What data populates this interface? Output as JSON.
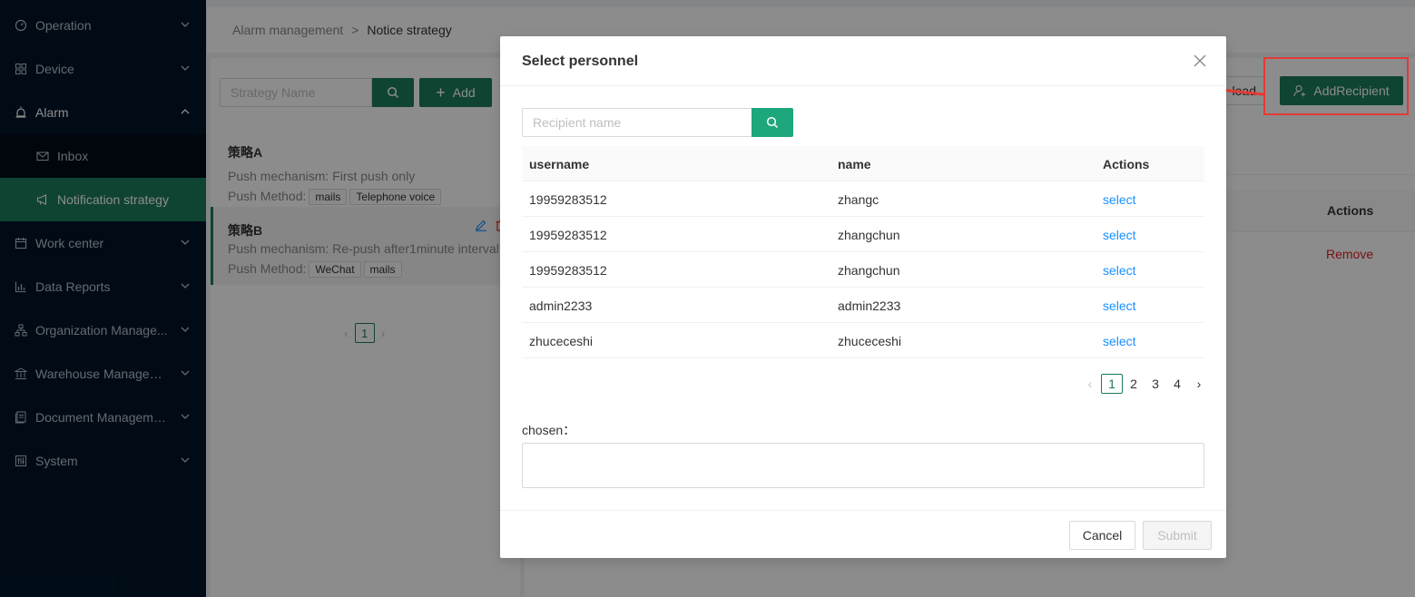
{
  "sidebar": {
    "items": [
      {
        "label": "Operation",
        "icon": "gauge-icon"
      },
      {
        "label": "Device",
        "icon": "grid-icon"
      },
      {
        "label": "Alarm",
        "icon": "alarm-icon"
      },
      {
        "label": "Inbox",
        "icon": "mail-icon"
      },
      {
        "label": "Notification strategy",
        "icon": "megaphone-icon"
      },
      {
        "label": "Work center",
        "icon": "calendar-icon"
      },
      {
        "label": "Data Reports",
        "icon": "bar-chart-icon"
      },
      {
        "label": "Organization Manage...",
        "icon": "org-tree-icon"
      },
      {
        "label": "Warehouse Manageme...",
        "icon": "bank-icon"
      },
      {
        "label": "Document Management",
        "icon": "document-icon"
      },
      {
        "label": "System",
        "icon": "settings-panel-icon"
      }
    ]
  },
  "breadcrumb": {
    "parent": "Alarm management",
    "separator": ">",
    "current": "Notice strategy"
  },
  "left_panel": {
    "search_placeholder": "Strategy Name",
    "add_label": "Add",
    "strategies": [
      {
        "name": "策略A",
        "mechanism": "Push mechanism: First push only",
        "method_label": "Push Method:",
        "tags": [
          "mails",
          "Telephone voice"
        ]
      },
      {
        "name": "策略B",
        "mechanism": "Push mechanism: Re-push after1minute interval",
        "method_label": "Push Method:",
        "tags": [
          "WeChat",
          "mails"
        ]
      }
    ],
    "page": "1"
  },
  "right_panel": {
    "upload_label": "load",
    "add_recipient_label": "AddRecipient",
    "actions_header": "Actions",
    "remove_label": "Remove"
  },
  "modal": {
    "title": "Select personnel",
    "search_placeholder": "Recipient name",
    "columns": [
      "username",
      "name",
      "Actions"
    ],
    "rows": [
      {
        "username": "19959283512",
        "name": "zhangc",
        "action": "select"
      },
      {
        "username": "19959283512",
        "name": "zhangchun",
        "action": "select"
      },
      {
        "username": "19959283512",
        "name": "zhangchun",
        "action": "select"
      },
      {
        "username": "admin2233",
        "name": "admin2233",
        "action": "select"
      },
      {
        "username": "zhuceceshi",
        "name": "zhuceceshi",
        "action": "select"
      }
    ],
    "pages": [
      "1",
      "2",
      "3",
      "4"
    ],
    "current_page": "1",
    "chosen_label": "chosen：",
    "cancel_label": "Cancel",
    "submit_label": "Submit"
  },
  "colors": {
    "brand_green": "#1c7a5c",
    "search_green": "#1ea77d",
    "link_blue": "#1890ff",
    "danger_red": "#e02020",
    "annotation_red": "#e53935",
    "sidebar_bg": "#001529"
  }
}
